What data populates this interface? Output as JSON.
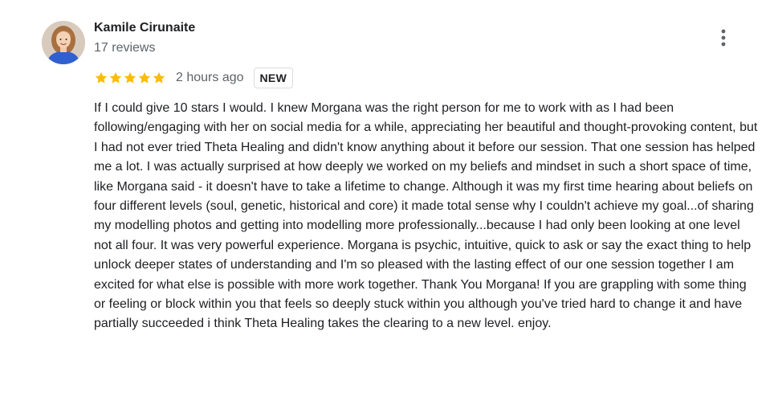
{
  "reviewer": {
    "name": "Kamile Cirunaite",
    "review_count": "17 reviews"
  },
  "review": {
    "rating": 5,
    "rating_max": 5,
    "time": "2 hours ago",
    "badge": "NEW",
    "text": "If I could give 10 stars I would. I knew Morgana was the right person for me to work with as I had been following/engaging with her on social media for a while, appreciating her beautiful and thought-provoking content, but I had not ever tried Theta Healing and didn't know anything about it before our session. That one session has helped me a lot. I was actually surprised at how deeply we worked on my beliefs and mindset in such a short space of time, like Morgana said - it doesn't have to take a lifetime to change. Although it was my first time hearing about beliefs on four different levels (soul, genetic, historical and core) it made total sense why I couldn't achieve my goal...of sharing my modelling photos and getting into modelling more professionally...because I had only been looking at one level not all four. It was very powerful experience. Morgana is psychic, intuitive, quick to ask or say the exact thing to help unlock deeper states of understanding and I'm so pleased with the lasting effect of our one session together I am excited for what else is possible with more work together. Thank You Morgana! If you are grappling with some thing or feeling or block within you that feels so deeply stuck within you although you've tried hard to change it and have partially succeeded i think Theta Healing takes the clearing to a new level. enjoy."
  },
  "colors": {
    "star": "#fbbc04",
    "text": "#202124",
    "secondary_text": "#5f6368",
    "badge_border": "#dadce0"
  },
  "icons": {
    "star": "star-icon",
    "more": "more-vert-icon"
  }
}
